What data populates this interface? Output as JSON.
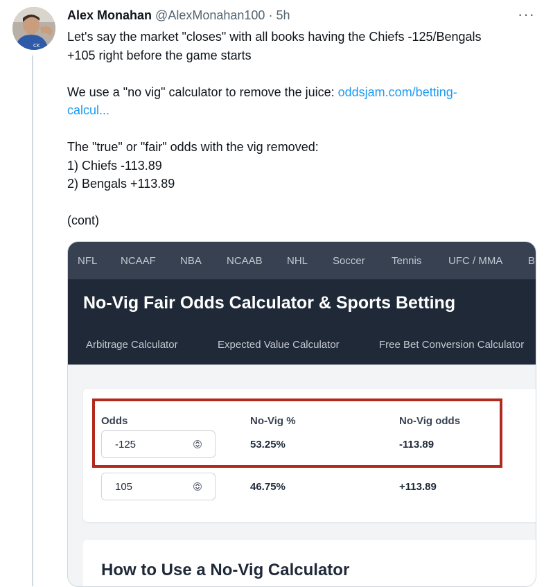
{
  "tweet": {
    "name": "Alex Monahan",
    "handle": "@AlexMonahan100",
    "separator": "·",
    "time": "5h",
    "more": "···",
    "line1": "Let's say the market \"closes\" with all books having the Chiefs -125/Bengals",
    "line2": "+105 right before the game starts",
    "line3": "We use a \"no vig\" calculator to remove the juice: ",
    "link_part1": "oddsjam.com/betting-",
    "link_part2": "calcul...",
    "line4": "The \"true\" or \"fair\" odds with the vig removed:",
    "line5": "1) Chiefs -113.89",
    "line6": "2) Bengals +113.89",
    "line7": "(cont)",
    "link_color": "#1d9bf0"
  },
  "card": {
    "top_nav": [
      "NFL",
      "NCAAF",
      "NBA",
      "NCAAB",
      "NHL",
      "Soccer",
      "Tennis",
      "UFC / MMA",
      "B"
    ],
    "title": "No-Vig Fair Odds Calculator & Sports Betting",
    "sub_nav": [
      "Arbitrage Calculator",
      "Expected Value Calculator",
      "Free Bet Conversion Calculator"
    ],
    "table": {
      "headers": [
        "Odds",
        "No-Vig %",
        "No-Vig odds"
      ],
      "rows": [
        {
          "odds": "-125",
          "pct": "53.25%",
          "fair": "-113.89"
        },
        {
          "odds": "105",
          "pct": "46.75%",
          "fair": "+113.89"
        }
      ],
      "highlight_color": "#b22a1e"
    },
    "section_heading": "How to Use a No-Vig Calculator"
  }
}
